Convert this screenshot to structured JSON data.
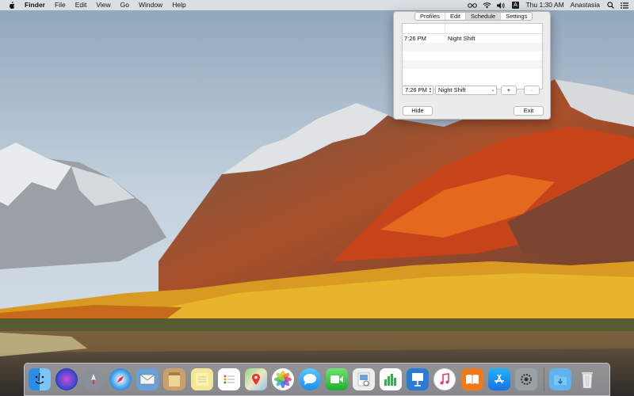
{
  "menubar": {
    "apple_icon": "apple-icon",
    "app_name": "Finder",
    "menus": [
      "File",
      "Edit",
      "View",
      "Go",
      "Window",
      "Help"
    ],
    "status_icons": [
      "glasses-icon",
      "wifi-icon",
      "volume-icon",
      "input-source-icon"
    ],
    "input_source_letter": "A",
    "clock": "Thu 1:30 AM",
    "user": "Anastasia",
    "spotlight_icon": "search-icon",
    "notifications_icon": "notification-center-icon"
  },
  "app_window": {
    "tabs": [
      "Profiles",
      "Edit",
      "Schedule",
      "Settings"
    ],
    "active_tab": "Schedule",
    "schedule_rows": [
      {
        "time": "7:26 PM",
        "profile": "Night Shift"
      }
    ],
    "time_field": "7:26 PM",
    "profile_select": "Night Shift",
    "add_label": "+",
    "remove_label": "-",
    "hide_label": "Hide",
    "exit_label": "Exit"
  },
  "dock": {
    "apps": [
      "Finder",
      "Siri",
      "Launchpad",
      "Safari",
      "Mail",
      "Notes",
      "Stickies",
      "Reminders",
      "Maps",
      "Photos",
      "Messages",
      "FaceTime",
      "Preview",
      "Numbers",
      "Keynote",
      "Music",
      "Books",
      "App Store",
      "System Preferences"
    ],
    "others": [
      "Downloads",
      "Trash"
    ]
  },
  "colors": {
    "menubar_bg": "#ebebeb",
    "popover_bg": "#ececec",
    "sky": "#b7c8d8",
    "autumn_orange": "#d35a1c",
    "lake": "#5a5148"
  }
}
